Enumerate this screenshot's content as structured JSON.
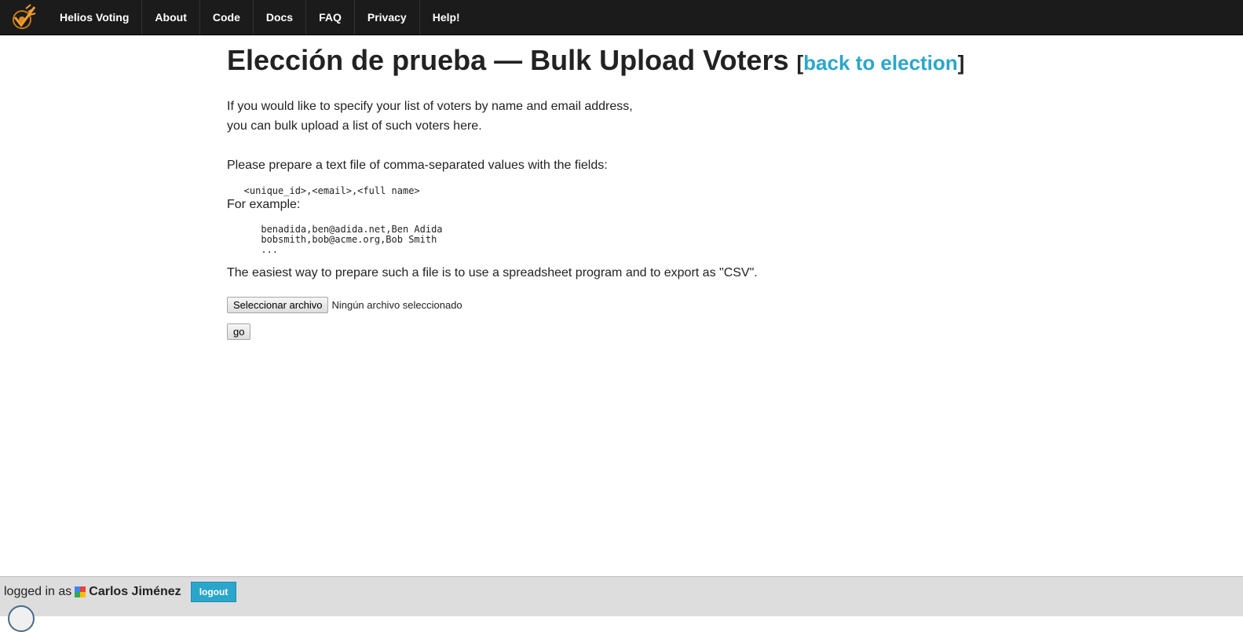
{
  "nav": {
    "items": [
      {
        "label": "Helios Voting"
      },
      {
        "label": "About"
      },
      {
        "label": "Code"
      },
      {
        "label": "Docs"
      },
      {
        "label": "FAQ"
      },
      {
        "label": "Privacy"
      },
      {
        "label": "Help!"
      }
    ]
  },
  "page": {
    "title": "Elección de prueba — Bulk Upload Voters",
    "bracket_open": "[",
    "back_link": "back to election",
    "bracket_close": "]",
    "intro_line1": "If you would like to specify your list of voters by name and email address,",
    "intro_line2": "you can bulk upload a list of such voters here.",
    "prepare_text": "Please prepare a text file of comma-separated values with the fields:",
    "fields_format": "   <unique_id>,<email>,<full name>",
    "example_label": "For example:",
    "example_block": "      benadida,ben@adida.net,Ben Adida\n      bobsmith,bob@acme.org,Bob Smith\n      ...",
    "csv_tip": "The easiest way to prepare such a file is to use a spreadsheet program and to export as \"CSV\".",
    "file_button": "Seleccionar archivo",
    "file_status": "Ningún archivo seleccionado",
    "go_button": "go"
  },
  "footer": {
    "logged_in_as": "logged in as",
    "username": "Carlos Jiménez",
    "logout": "logout"
  },
  "colors": {
    "nav_bg": "#1b1b1b",
    "link": "#2ba6cb",
    "footer_bg": "#dddddd"
  }
}
